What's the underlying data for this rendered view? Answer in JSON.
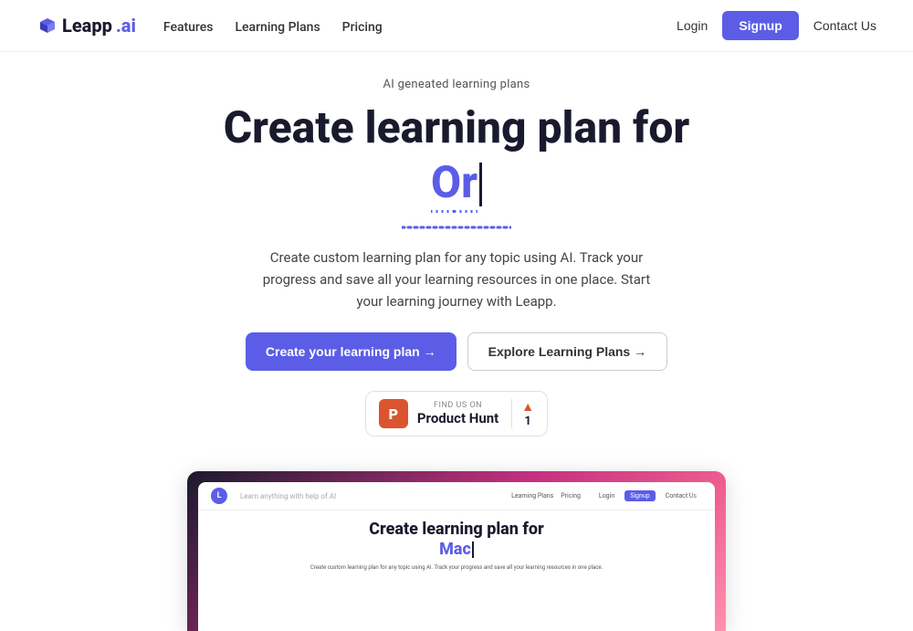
{
  "brand": {
    "logo_text": "Leapp",
    "logo_suffix": ".ai",
    "logo_icon": "⚙"
  },
  "navbar": {
    "links": [
      {
        "label": "Features",
        "href": "#"
      },
      {
        "label": "Learning Plans",
        "href": "#"
      },
      {
        "label": "Pricing",
        "href": "#"
      }
    ],
    "login_label": "Login",
    "signup_label": "Signup",
    "contact_label": "Contact Us"
  },
  "hero": {
    "tag": "AI geneated learning plans",
    "title_line1": "Create learning plan for",
    "animated_word": "Or",
    "description": "Create custom learning plan for any topic using AI. Track your progress and save all your learning resources in one place. Start your learning journey with Leapp.",
    "cta_primary": "Create your learning plan →",
    "cta_secondary": "Explore Learning Plans →"
  },
  "product_hunt": {
    "find_us_text": "FIND US ON",
    "name": "Product Hunt",
    "logo_letter": "P",
    "upvote_count": "1"
  },
  "video_preview": {
    "logo_letter": "L",
    "nav_text": "Learn anything with help of AI",
    "nav_links": [
      "Learning Plans",
      "Pricing"
    ],
    "login_label": "Login",
    "signup_label": "Signup",
    "contact_label": "Contact Us",
    "title1": "Create learning plan for",
    "title2_word": "Mac",
    "description": "Create custom learning plan for any topic using AI. Track your progress and save all your learning resources in one place."
  },
  "colors": {
    "primary": "#5b5de7",
    "accent": "#da552f",
    "text_dark": "#1a1a2e",
    "text_muted": "#888"
  }
}
